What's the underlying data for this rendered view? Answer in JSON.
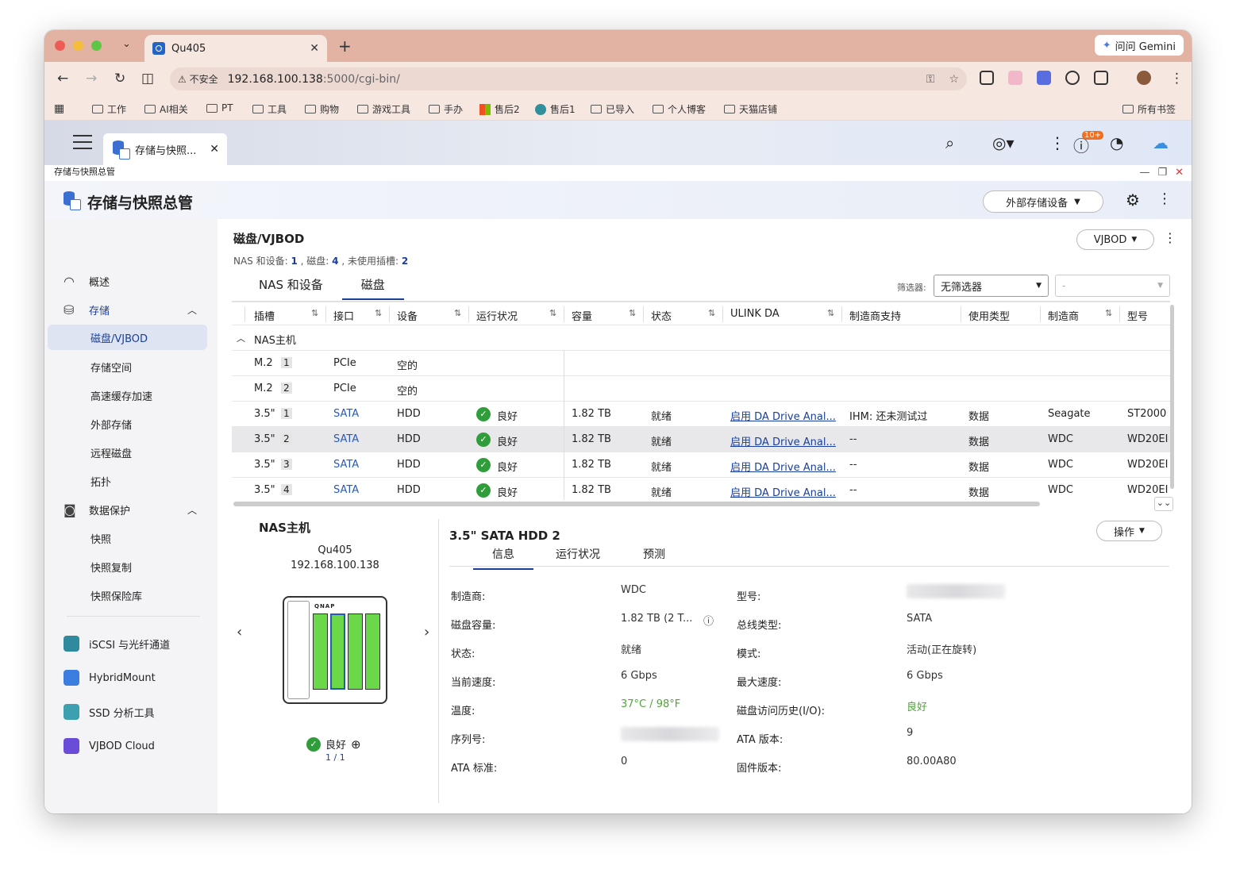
{
  "browser": {
    "tab_title": "Qu405",
    "gemini_label": "问问 Gemini",
    "insecure_label": "不安全",
    "url_host": "192.168.100.138",
    "url_path": ":5000/cgi-bin/"
  },
  "bookmarks": [
    "工作",
    "AI相关",
    "PT",
    "工具",
    "购物",
    "游戏工具",
    "手办",
    "售后2",
    "售后1",
    "已导入",
    "个人博客",
    "天猫店铺"
  ],
  "bookmarks_all": "所有书签",
  "qts": {
    "app_tab": "存储与快照...",
    "badge": "10+"
  },
  "window_title": "存储与快照总管",
  "app": {
    "title": "存储与快照总管",
    "external_button": "外部存储设备"
  },
  "sidebar": {
    "overview": "概述",
    "storage": "存储",
    "storage_items": [
      "磁盘/VJBOD",
      "存储空间",
      "高速缓存加速",
      "外部存储",
      "远程磁盘",
      "拓扑"
    ],
    "protection": "数据保护",
    "protection_items": [
      "快照",
      "快照复制",
      "快照保险库"
    ],
    "apps": [
      "iSCSI 与光纤通道",
      "HybridMount",
      "SSD 分析工具",
      "VJBOD Cloud"
    ]
  },
  "main": {
    "title": "磁盘/VJBOD",
    "summary_pre": "NAS 和设备: ",
    "summary_nas": "1",
    "summary_mid": " , 磁盘: ",
    "summary_disks": "4",
    "summary_mid2": " , 未使用插槽: ",
    "summary_unused": "2",
    "vjbod_button": "VJBOD",
    "tabs": [
      "NAS 和设备",
      "磁盘"
    ],
    "filter_label": "筛选器:",
    "filter_value": "无筛选器",
    "filter2_value": "-"
  },
  "table": {
    "headers": [
      "插槽",
      "接口",
      "设备",
      "运行状况",
      "容量",
      "状态",
      "ULINK DA",
      "制造商支持",
      "使用类型",
      "制造商",
      "型号"
    ],
    "group": "NAS主机",
    "rows": [
      {
        "slot": "M.2",
        "num": "1",
        "iface": "PCIe",
        "device": "空的",
        "health": "",
        "cap": "",
        "state": "",
        "da": "",
        "support": "",
        "usage": "",
        "vendor": "",
        "model": ""
      },
      {
        "slot": "M.2",
        "num": "2",
        "iface": "PCIe",
        "device": "空的",
        "health": "",
        "cap": "",
        "state": "",
        "da": "",
        "support": "",
        "usage": "",
        "vendor": "",
        "model": ""
      },
      {
        "slot": "3.5\"",
        "num": "1",
        "iface": "SATA",
        "device": "HDD",
        "health": "良好",
        "cap": "1.82 TB",
        "state": "就绪",
        "da": "启用 DA Drive Anal...",
        "support": "IHM: 还未测试过",
        "usage": "数据",
        "vendor": "Seagate",
        "model": "ST2000"
      },
      {
        "slot": "3.5\"",
        "num": "2",
        "iface": "SATA",
        "device": "HDD",
        "health": "良好",
        "cap": "1.82 TB",
        "state": "就绪",
        "da": "启用 DA Drive Anal...",
        "support": "--",
        "usage": "数据",
        "vendor": "WDC",
        "model": "WD20EI"
      },
      {
        "slot": "3.5\"",
        "num": "3",
        "iface": "SATA",
        "device": "HDD",
        "health": "良好",
        "cap": "1.82 TB",
        "state": "就绪",
        "da": "启用 DA Drive Anal...",
        "support": "--",
        "usage": "数据",
        "vendor": "WDC",
        "model": "WD20EI"
      },
      {
        "slot": "3.5\"",
        "num": "4",
        "iface": "SATA",
        "device": "HDD",
        "health": "良好",
        "cap": "1.82 TB",
        "state": "就绪",
        "da": "启用 DA Drive Anal...",
        "support": "--",
        "usage": "数据",
        "vendor": "WDC",
        "model": "WD20EI"
      }
    ]
  },
  "nas": {
    "title": "NAS主机",
    "name": "Qu405",
    "ip": "192.168.100.138",
    "logo": "QNAP",
    "status": "良好",
    "page": "1 / 1"
  },
  "detail": {
    "title": "3.5\" SATA HDD 2",
    "op_button": "操作",
    "tabs": [
      "信息",
      "运行状况",
      "预测"
    ],
    "left": [
      {
        "k": "制造商:",
        "v": "WDC"
      },
      {
        "k": "磁盘容量:",
        "v": "1.82 TB (2 T..."
      },
      {
        "k": "状态:",
        "v": "就绪"
      },
      {
        "k": "当前速度:",
        "v": "6 Gbps"
      },
      {
        "k": "温度:",
        "v": "37°C / 98°F"
      },
      {
        "k": "序列号:",
        "v": ""
      },
      {
        "k": "ATA 标准:",
        "v": "0"
      }
    ],
    "right": [
      {
        "k": "型号:",
        "v": ""
      },
      {
        "k": "总线类型:",
        "v": "SATA"
      },
      {
        "k": "模式:",
        "v": "活动(正在旋转)"
      },
      {
        "k": "最大速度:",
        "v": "6 Gbps"
      },
      {
        "k": "磁盘访问历史(I/O):",
        "v": "良好"
      },
      {
        "k": "ATA 版本:",
        "v": "9"
      },
      {
        "k": "固件版本:",
        "v": "80.00A80"
      }
    ]
  },
  "colors": {
    "accent": "#1a3f9a",
    "ok": "#2f9e3a",
    "bay": "#6bd84a",
    "tabbar": "#e2b3a3"
  }
}
